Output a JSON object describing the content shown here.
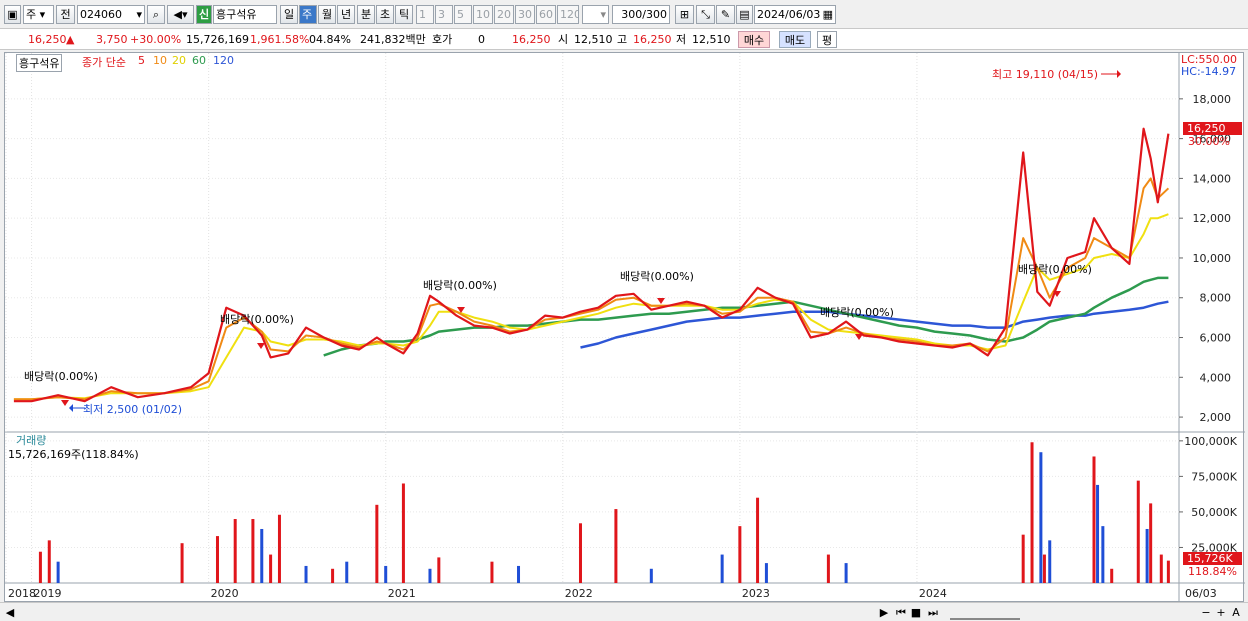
{
  "toolbar": {
    "market": "주",
    "prev_label": "전",
    "code": "024060",
    "credit_badge": "신",
    "name": "흥구석유",
    "periods": [
      "일",
      "주",
      "월",
      "년",
      "분",
      "초",
      "틱"
    ],
    "active_period": "주",
    "intervals": [
      "1",
      "3",
      "5",
      "10",
      "20",
      "30",
      "60",
      "120"
    ],
    "count": "300",
    "count_total": "/300",
    "date": "2024/06/03"
  },
  "quote": {
    "price": "16,250",
    "change": "3,750",
    "change_pct": "+30.00%",
    "volume": "15,726,169",
    "volume_pct": "1,961.58%",
    "turnover": "04.84%",
    "amount": "241,832백만",
    "hoga_label": "호가",
    "hoga_value": "0",
    "hoga_price": "16,250",
    "open_label": "시",
    "open": "12,510",
    "high_label": "고",
    "high": "16,250",
    "low_label": "저",
    "low": "12,510",
    "buy_label": "매수",
    "sell_label": "매도",
    "eval_label": "평"
  },
  "legend": {
    "stock": "흥구석유",
    "ma_label": "종가 단순",
    "ma5": "5",
    "ma10": "10",
    "ma20": "20",
    "ma60": "60",
    "ma120": "120",
    "lc": "LC:550.00",
    "hc": "HC:-14.97"
  },
  "annotations": {
    "high": "최고 19,110 (04/15)",
    "low": "최저 2,500 (01/02)",
    "dividends": [
      "배당락(0.00%)",
      "배당락(0.00%)",
      "배당락(0.00%)",
      "배당락(0.00%)",
      "배당락(0.00%)",
      "배당락(0.00%)"
    ],
    "price_tag": "16,250",
    "price_tag_pct": "30.00%",
    "volume_title": "거래량",
    "volume_value": "15,726,169주(118.84%)",
    "volume_tag": "15,726K",
    "volume_tag_pct": "118.84%"
  },
  "colors": {
    "up": "#e0161b",
    "down": "#1f4ed6",
    "ma5": "#e0161b",
    "ma10": "#f08a14",
    "ma20": "#f0e010",
    "ma60": "#2e9b4f",
    "ma120": "#2d56d6"
  },
  "chart_data": {
    "type": "line",
    "x_ticks": [
      "2018",
      "2019",
      "2020",
      "2021",
      "2022",
      "2023",
      "2024",
      "06/03"
    ],
    "price_ticks": [
      2000,
      4000,
      6000,
      8000,
      10000,
      12000,
      14000,
      16000,
      18000
    ],
    "price_tick_labels": [
      "2,000",
      "4,000",
      "6,000",
      "8,000",
      "10,000",
      "12,000",
      "14,000",
      "16,000",
      "18,000"
    ],
    "ylim_price": [
      1300,
      19400
    ],
    "volume_ticks": [
      25000,
      50000,
      75000,
      100000
    ],
    "volume_tick_labels": [
      "25,000K",
      "50,000K",
      "75,000K",
      "100,000K"
    ],
    "ylim_volume": [
      0,
      102000
    ],
    "x": [
      2017.9,
      2018.0,
      2018.15,
      2018.3,
      2018.45,
      2018.6,
      2018.75,
      2018.9,
      2019.0,
      2019.1,
      2019.2,
      2019.3,
      2019.35,
      2019.45,
      2019.55,
      2019.65,
      2019.75,
      2019.85,
      2019.95,
      2020.0,
      2020.1,
      2020.18,
      2020.25,
      2020.3,
      2020.4,
      2020.5,
      2020.6,
      2020.7,
      2020.8,
      2020.9,
      2021.0,
      2021.1,
      2021.2,
      2021.3,
      2021.4,
      2021.5,
      2021.6,
      2021.7,
      2021.8,
      2021.9,
      2022.0,
      2022.1,
      2022.2,
      2022.3,
      2022.4,
      2022.5,
      2022.6,
      2022.7,
      2022.8,
      2022.9,
      2023.0,
      2023.1,
      2023.2,
      2023.3,
      2023.4,
      2023.5,
      2023.6,
      2023.68,
      2023.75,
      2023.85,
      2023.95,
      2024.0,
      2024.1,
      2024.2,
      2024.28,
      2024.32,
      2024.36,
      2024.42
    ],
    "series": [
      {
        "name": "5",
        "values": [
          2800,
          2800,
          3100,
          2800,
          3500,
          3000,
          3200,
          3500,
          4200,
          7500,
          7100,
          6100,
          5000,
          5200,
          6500,
          6000,
          5600,
          5400,
          6000,
          5700,
          5200,
          6200,
          8100,
          7800,
          7100,
          6600,
          6500,
          6200,
          6400,
          7100,
          7000,
          7300,
          7500,
          8100,
          8200,
          7400,
          7600,
          7800,
          7600,
          7000,
          7400,
          8500,
          8000,
          7700,
          6000,
          6200,
          6800,
          6100,
          6000,
          5800,
          5700,
          5600,
          5500,
          5700,
          5100,
          6500,
          15300,
          8300,
          7600,
          10000,
          10300,
          12000,
          10500,
          9700,
          16500,
          15000,
          12800,
          16250
        ]
      },
      {
        "name": "10",
        "values": [
          2900,
          2900,
          3000,
          2900,
          3300,
          3200,
          3200,
          3400,
          3800,
          6500,
          7000,
          6300,
          5400,
          5300,
          6100,
          6000,
          5700,
          5500,
          5800,
          5700,
          5400,
          6000,
          7600,
          7700,
          7300,
          6800,
          6600,
          6300,
          6400,
          6900,
          7000,
          7200,
          7400,
          7900,
          8000,
          7600,
          7600,
          7700,
          7600,
          7200,
          7300,
          8000,
          8000,
          7800,
          6300,
          6200,
          6500,
          6200,
          6000,
          5900,
          5800,
          5600,
          5600,
          5700,
          5300,
          6000,
          11000,
          9500,
          8000,
          9500,
          10000,
          11000,
          10500,
          10000,
          13500,
          14000,
          13000,
          13500
        ]
      },
      {
        "name": "20",
        "values": [
          2900,
          2900,
          3000,
          2950,
          3200,
          3200,
          3200,
          3300,
          3500,
          5000,
          6500,
          6300,
          5800,
          5600,
          5900,
          5900,
          5800,
          5600,
          5700,
          5700,
          5600,
          5800,
          6600,
          7300,
          7300,
          7000,
          6800,
          6500,
          6400,
          6600,
          6800,
          7000,
          7200,
          7500,
          7700,
          7600,
          7600,
          7600,
          7600,
          7400,
          7400,
          7700,
          7900,
          7800,
          6900,
          6400,
          6300,
          6200,
          6100,
          6000,
          5900,
          5700,
          5600,
          5600,
          5400,
          5600,
          7800,
          9500,
          8900,
          9200,
          9500,
          10000,
          10200,
          10000,
          11200,
          12000,
          12000,
          12200
        ]
      },
      {
        "name": "60",
        "values": [
          null,
          null,
          null,
          null,
          null,
          null,
          null,
          null,
          null,
          null,
          null,
          null,
          null,
          null,
          null,
          5100,
          5400,
          5600,
          5700,
          5800,
          5800,
          5900,
          6100,
          6300,
          6400,
          6500,
          6500,
          6600,
          6600,
          6700,
          6800,
          6900,
          6900,
          7000,
          7100,
          7200,
          7200,
          7300,
          7400,
          7500,
          7500,
          7600,
          7700,
          7800,
          7600,
          7400,
          7200,
          7000,
          6800,
          6600,
          6500,
          6300,
          6200,
          6100,
          5900,
          5800,
          6000,
          6400,
          6800,
          7000,
          7200,
          7500,
          8000,
          8400,
          8800,
          8900,
          9000,
          9000
        ]
      },
      {
        "name": "120",
        "values": [
          null,
          null,
          null,
          null,
          null,
          null,
          null,
          null,
          null,
          null,
          null,
          null,
          null,
          null,
          null,
          null,
          null,
          null,
          null,
          null,
          null,
          null,
          null,
          null,
          null,
          null,
          null,
          null,
          null,
          null,
          null,
          5500,
          5700,
          6000,
          6200,
          6400,
          6600,
          6800,
          6900,
          7000,
          7000,
          7100,
          7200,
          7300,
          7300,
          7300,
          7200,
          7100,
          7000,
          6900,
          6800,
          6700,
          6600,
          6600,
          6500,
          6500,
          6800,
          6900,
          7000,
          7100,
          7100,
          7200,
          7300,
          7400,
          7500,
          7600,
          7700,
          7800
        ]
      }
    ],
    "volume_x": [
      2018.05,
      2018.1,
      2018.15,
      2018.85,
      2019.05,
      2019.15,
      2019.25,
      2019.3,
      2019.35,
      2019.4,
      2019.55,
      2019.7,
      2019.78,
      2019.95,
      2020.0,
      2020.1,
      2020.25,
      2020.3,
      2020.6,
      2020.75,
      2021.1,
      2021.3,
      2021.5,
      2021.9,
      2022.0,
      2022.1,
      2022.15,
      2022.5,
      2022.6,
      2023.6,
      2023.65,
      2023.7,
      2023.72,
      2023.75,
      2024.0,
      2024.02,
      2024.05,
      2024.1,
      2024.25,
      2024.3,
      2024.32,
      2024.38,
      2024.42
    ],
    "volume_values": [
      22000,
      30000,
      15000,
      28000,
      33000,
      45000,
      45000,
      38000,
      20000,
      48000,
      12000,
      10000,
      15000,
      55000,
      12000,
      70000,
      10000,
      18000,
      15000,
      12000,
      42000,
      52000,
      10000,
      20000,
      40000,
      60000,
      14000,
      20000,
      14000,
      34000,
      99000,
      92000,
      20000,
      30000,
      89000,
      69000,
      40000,
      10000,
      72000,
      38000,
      56000,
      20000,
      15726
    ],
    "volume_up": [
      true,
      true,
      false,
      true,
      true,
      true,
      true,
      false,
      true,
      true,
      false,
      true,
      false,
      true,
      false,
      true,
      false,
      true,
      true,
      false,
      true,
      true,
      false,
      false,
      true,
      true,
      false,
      true,
      false,
      true,
      true,
      false,
      true,
      false,
      true,
      false,
      false,
      true,
      true,
      false,
      true,
      true,
      true
    ]
  }
}
